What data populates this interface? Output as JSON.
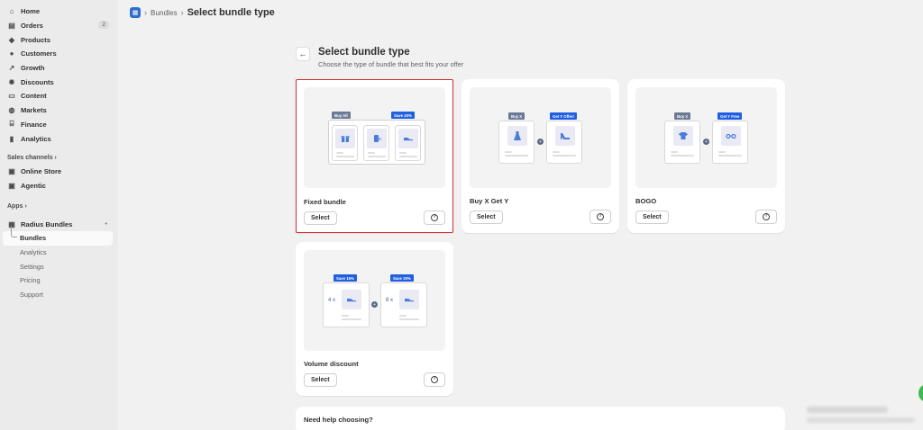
{
  "sidebar": {
    "items": [
      {
        "label": "Home",
        "icon": "home-icon",
        "glyph": "⌂"
      },
      {
        "label": "Orders",
        "icon": "orders-icon",
        "glyph": "▤",
        "badge": "2"
      },
      {
        "label": "Products",
        "icon": "tag-icon",
        "glyph": "◆"
      },
      {
        "label": "Customers",
        "icon": "person-icon",
        "glyph": "●"
      },
      {
        "label": "Growth",
        "icon": "growth-icon",
        "glyph": "↗"
      },
      {
        "label": "Discounts",
        "icon": "discount-icon",
        "glyph": "✹"
      },
      {
        "label": "Content",
        "icon": "content-icon",
        "glyph": "▭"
      },
      {
        "label": "Markets",
        "icon": "globe-icon",
        "glyph": "◍"
      },
      {
        "label": "Finance",
        "icon": "bank-icon",
        "glyph": "⌸"
      },
      {
        "label": "Analytics",
        "icon": "chart-icon",
        "glyph": "▮"
      }
    ],
    "sales_channels_label": "Sales channels",
    "channels": [
      {
        "label": "Online Store",
        "icon": "store-icon",
        "glyph": "▣"
      },
      {
        "label": "Agentic",
        "icon": "agentic-icon",
        "glyph": "▣"
      }
    ],
    "apps_label": "Apps",
    "app": {
      "label": "Radius Bundles",
      "icon": "app-icon",
      "glyph": "▦",
      "menu": "•"
    },
    "app_subitems": [
      "Bundles",
      "Analytics",
      "Settings",
      "Pricing",
      "Support"
    ],
    "section_chevron": "›"
  },
  "topbar": {
    "crumb": "Bundles",
    "title": "Select bundle type",
    "separator": "›"
  },
  "header": {
    "back_glyph": "←",
    "title": "Select bundle type",
    "subtitle": "Choose the type of bundle that best fits your offer"
  },
  "cards": {
    "fixed": {
      "name": "Fixed bundle",
      "select": "Select",
      "tag1": "Buy All",
      "tag2": "Save 20%"
    },
    "bxgy": {
      "name": "Buy X Get Y",
      "select": "Select",
      "tag1": "Buy X",
      "tag2": "Get Y Offer!"
    },
    "bogo": {
      "name": "BOGO",
      "select": "Select",
      "tag1": "Buy X",
      "tag2": "Get Y Free"
    },
    "volume": {
      "name": "Volume discount",
      "select": "Select",
      "tag1": "Save 15%",
      "tag2": "Save 20%",
      "qty1": "4 x",
      "qty2": "8 x"
    }
  },
  "help": {
    "title": "Need help choosing?",
    "glyph": "?"
  },
  "colors": {
    "accent": "#1f5fe0",
    "selected_border": "#d72c2c",
    "icon_blue": "#4a7bd8"
  }
}
